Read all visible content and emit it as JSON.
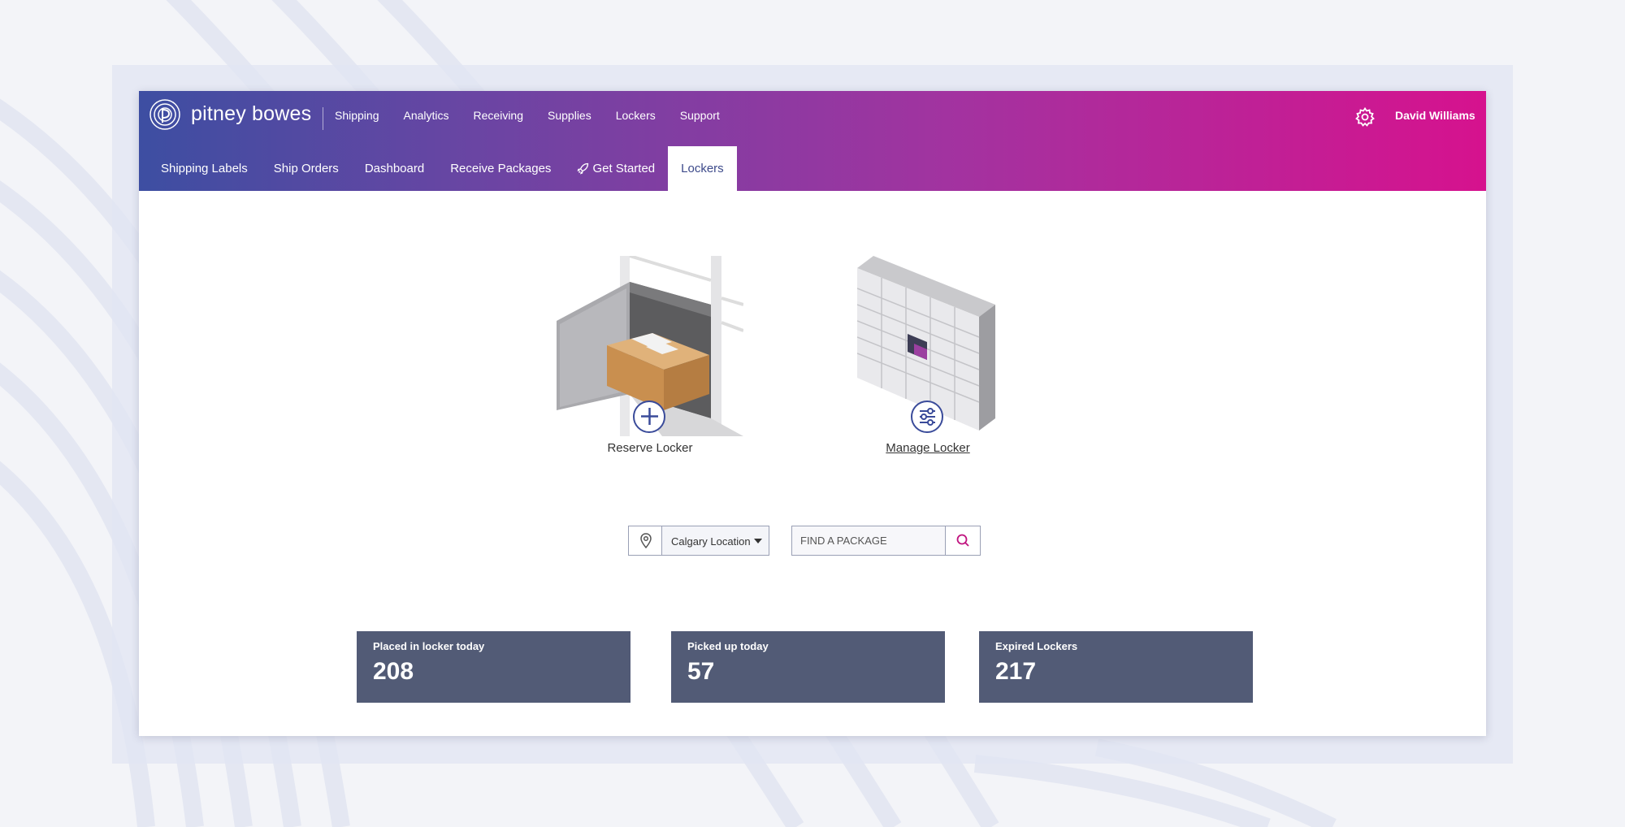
{
  "header": {
    "brand": "pitney bowes",
    "nav": [
      "Shipping",
      "Analytics",
      "Receiving",
      "Supplies",
      "Lockers",
      "Support"
    ],
    "user": "David Williams",
    "tabs": [
      "Shipping Labels",
      "Ship Orders",
      "Dashboard",
      "Receive Packages",
      "Get Started",
      "Lockers"
    ],
    "active_tab": "Lockers"
  },
  "actions": {
    "reserve": "Reserve Locker",
    "manage": "Manage Locker"
  },
  "search": {
    "location": "Calgary Location",
    "placeholder": "FIND A PACKAGE"
  },
  "stats": [
    {
      "label": "Placed in locker today",
      "value": "208"
    },
    {
      "label": "Picked up today",
      "value": "57"
    },
    {
      "label": "Expired Lockers",
      "value": "217"
    }
  ],
  "colors": {
    "gradient_start": "#3d4ea2",
    "gradient_end": "#d6128e",
    "stat_card": "#525b76",
    "icon_blue": "#3a4b9a"
  }
}
